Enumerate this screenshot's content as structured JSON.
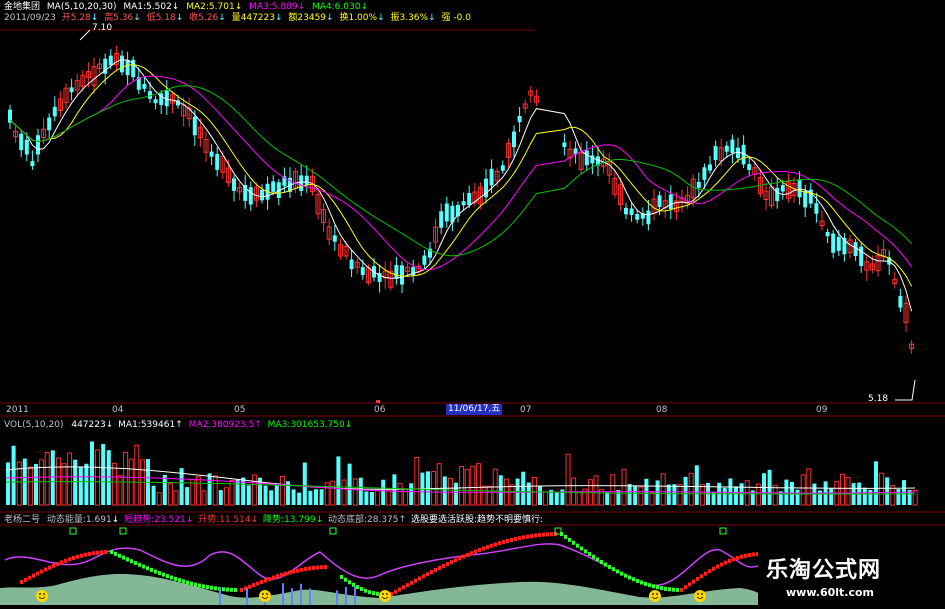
{
  "header": {
    "stock_name": "金地集团",
    "ma_label": "MA(5,10,20,30)",
    "ma1": "MA1:5.502",
    "ma2": "MA2:5.701",
    "ma3": "MA3:5.889",
    "ma4": "MA4:6.030",
    "arrow_down": "↓",
    "arrow_up": "↑",
    "date": "2011/09/23",
    "open": "开5.28",
    "high": "高5.36",
    "low": "低5.18",
    "close": "收5.26",
    "volume": "量447223",
    "amount": "额23459",
    "turnover": "换1.00%",
    "amplitude": "振3.36%",
    "strength": "强 -0.0"
  },
  "price_marks": {
    "high": "7.10",
    "low": "5.18"
  },
  "time_axis": {
    "year": "2011",
    "months": [
      "04",
      "05",
      "06",
      "07",
      "08",
      "09"
    ],
    "cursor_date": "11/06/17,五"
  },
  "volume_header": {
    "label": "VOL(5,10,20)",
    "value": "447223",
    "ma1": "MA1:539461",
    "ma2": "MA2:380923.5",
    "ma3": "MA3:301653.750"
  },
  "indicator_header": {
    "name": "老杨二号",
    "energy": "动态能量:1.691",
    "short_trend": "短趋势:23.521",
    "rise": "升势:11.514",
    "fall": "降势:13.799",
    "bottom": "动态底部:28.375",
    "advice1": "选股要选活跃股",
    "advice2": "趋势不明要慎行"
  },
  "watermark": {
    "title": "乐淘公式网",
    "url": "www.60lt.com"
  },
  "colors": {
    "up": "#ff3030",
    "down": "#54ffff",
    "ma5": "#ffffff",
    "ma10": "#ffff00",
    "ma20": "#ff00ff",
    "ma30": "#00c000",
    "panel_border": "#7a0000"
  }
}
